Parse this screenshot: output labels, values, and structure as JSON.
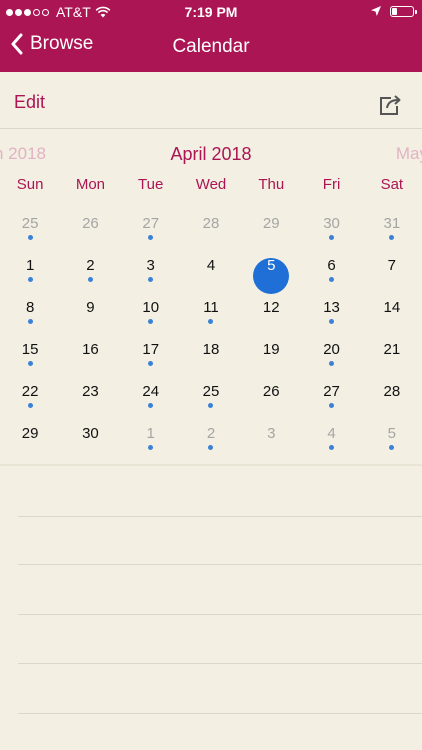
{
  "status": {
    "carrier": "AT&T",
    "time": "7:19 PM"
  },
  "nav": {
    "back_label": "Browse",
    "title": "Calendar"
  },
  "toolbar": {
    "edit_label": "Edit"
  },
  "calendar": {
    "prev_month": "n 2018",
    "current_month": "April 2018",
    "next_month": "May",
    "weekdays": [
      "Sun",
      "Mon",
      "Tue",
      "Wed",
      "Thu",
      "Fri",
      "Sat"
    ],
    "weeks": [
      [
        {
          "d": "25",
          "o": true,
          "e": true
        },
        {
          "d": "26",
          "o": true,
          "e": false
        },
        {
          "d": "27",
          "o": true,
          "e": true
        },
        {
          "d": "28",
          "o": true,
          "e": false
        },
        {
          "d": "29",
          "o": true,
          "e": false
        },
        {
          "d": "30",
          "o": true,
          "e": true
        },
        {
          "d": "31",
          "o": true,
          "e": true
        }
      ],
      [
        {
          "d": "1",
          "o": false,
          "e": true
        },
        {
          "d": "2",
          "o": false,
          "e": true
        },
        {
          "d": "3",
          "o": false,
          "e": true
        },
        {
          "d": "4",
          "o": false,
          "e": false
        },
        {
          "d": "5",
          "o": false,
          "e": false,
          "s": true
        },
        {
          "d": "6",
          "o": false,
          "e": true
        },
        {
          "d": "7",
          "o": false,
          "e": false
        }
      ],
      [
        {
          "d": "8",
          "o": false,
          "e": true
        },
        {
          "d": "9",
          "o": false,
          "e": false
        },
        {
          "d": "10",
          "o": false,
          "e": true
        },
        {
          "d": "11",
          "o": false,
          "e": true
        },
        {
          "d": "12",
          "o": false,
          "e": false
        },
        {
          "d": "13",
          "o": false,
          "e": true
        },
        {
          "d": "14",
          "o": false,
          "e": false
        }
      ],
      [
        {
          "d": "15",
          "o": false,
          "e": true
        },
        {
          "d": "16",
          "o": false,
          "e": false
        },
        {
          "d": "17",
          "o": false,
          "e": true
        },
        {
          "d": "18",
          "o": false,
          "e": false
        },
        {
          "d": "19",
          "o": false,
          "e": false
        },
        {
          "d": "20",
          "o": false,
          "e": true
        },
        {
          "d": "21",
          "o": false,
          "e": false
        }
      ],
      [
        {
          "d": "22",
          "o": false,
          "e": true
        },
        {
          "d": "23",
          "o": false,
          "e": false
        },
        {
          "d": "24",
          "o": false,
          "e": true
        },
        {
          "d": "25",
          "o": false,
          "e": true
        },
        {
          "d": "26",
          "o": false,
          "e": false
        },
        {
          "d": "27",
          "o": false,
          "e": true
        },
        {
          "d": "28",
          "o": false,
          "e": false
        }
      ],
      [
        {
          "d": "29",
          "o": false,
          "e": false
        },
        {
          "d": "30",
          "o": false,
          "e": false
        },
        {
          "d": "1",
          "o": true,
          "e": true
        },
        {
          "d": "2",
          "o": true,
          "e": true
        },
        {
          "d": "3",
          "o": true,
          "e": false
        },
        {
          "d": "4",
          "o": true,
          "e": true
        },
        {
          "d": "5",
          "o": true,
          "e": true
        }
      ]
    ]
  },
  "colors": {
    "brand": "#ab1553",
    "selected": "#1f6fd6",
    "event_dot": "#3b82d6",
    "background": "#f3efe3"
  }
}
